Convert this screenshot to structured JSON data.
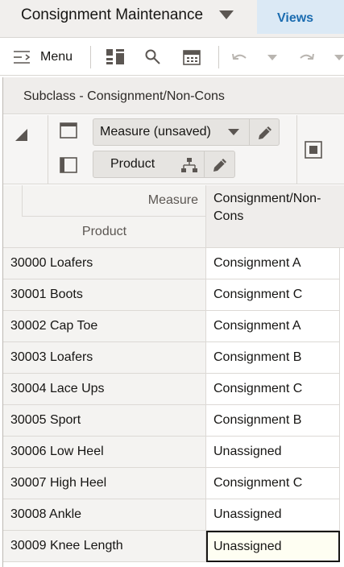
{
  "header": {
    "title": "Consignment Maintenance",
    "views_label": "Views"
  },
  "toolbar": {
    "menu_label": "Menu",
    "icons": [
      "hamburger-icon",
      "panels-icon",
      "search-icon",
      "calendar-icon",
      "undo-icon",
      "chevron-down-icon",
      "redo-icon",
      "chevron-down-icon"
    ]
  },
  "panel": {
    "title": "Subclass - Consignment/Non-Cons",
    "measure_pill": "Measure (unsaved)",
    "product_pill": "Product"
  },
  "grid": {
    "corner_measure": "Measure",
    "corner_product": "Product",
    "column_header_line1": "Consignment/Non-",
    "column_header_line2": "Cons",
    "rows": [
      {
        "product": "30000 Loafers",
        "value": "Consignment A"
      },
      {
        "product": "30001 Boots",
        "value": "Consignment C"
      },
      {
        "product": "30002 Cap Toe",
        "value": "Consignment A"
      },
      {
        "product": "30003 Loafers",
        "value": "Consignment B"
      },
      {
        "product": "30004 Lace Ups",
        "value": "Consignment C"
      },
      {
        "product": "30005 Sport",
        "value": "Consignment B"
      },
      {
        "product": "30006 Low Heel",
        "value": "Unassigned"
      },
      {
        "product": "30007 High Heel",
        "value": "Consignment C"
      },
      {
        "product": "30008 Ankle",
        "value": "Unassigned"
      },
      {
        "product": "30009 Knee Length",
        "value": "Unassigned"
      }
    ],
    "selected_row": 9
  },
  "colors": {
    "accent": "#1b6cb0",
    "views_tab_bg": "#dbe9f5",
    "header_bg": "#f1efed"
  }
}
